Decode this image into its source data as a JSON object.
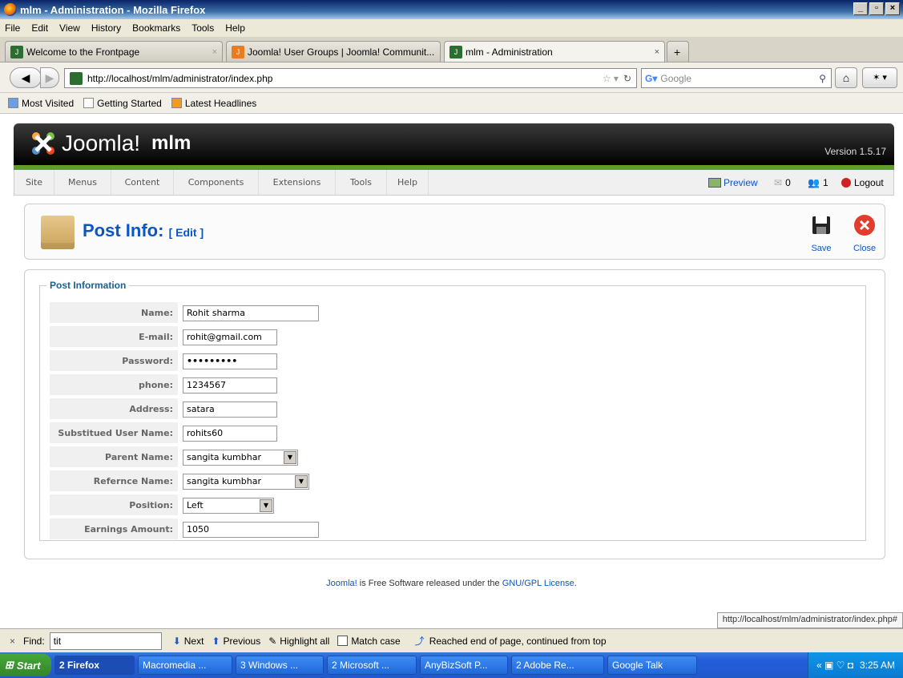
{
  "window": {
    "title": "mlm - Administration - Mozilla Firefox"
  },
  "menubar": [
    "File",
    "Edit",
    "View",
    "History",
    "Bookmarks",
    "Tools",
    "Help"
  ],
  "tabs": [
    {
      "label": "Welcome to the Frontpage"
    },
    {
      "label": "Joomla! User Groups | Joomla! Communit..."
    },
    {
      "label": "mlm - Administration"
    }
  ],
  "nav": {
    "url": "http://localhost/mlm/administrator/index.php",
    "search_placeholder": "Google"
  },
  "bookmarks": [
    "Most Visited",
    "Getting Started",
    "Latest Headlines"
  ],
  "joomla": {
    "brand": "Joomla!",
    "site": "mlm",
    "version": "Version 1.5.17",
    "menu": [
      "Site",
      "Menus",
      "Content",
      "Components",
      "Extensions",
      "Tools",
      "Help"
    ],
    "preview": "Preview",
    "messages": "0",
    "users": "1",
    "logout": "Logout"
  },
  "toolbar": {
    "title": "Post Info:",
    "subtitle": "[ Edit ]",
    "save": "Save",
    "close": "Close"
  },
  "form": {
    "legend": "Post Information",
    "fields": [
      {
        "label": "Name:",
        "value": "Rohit sharma",
        "type": "text"
      },
      {
        "label": "E-mail:",
        "value": "rohit@gmail.com",
        "type": "text"
      },
      {
        "label": "Password:",
        "value": "•••••••••",
        "type": "text"
      },
      {
        "label": "phone:",
        "value": "1234567",
        "type": "text"
      },
      {
        "label": "Address:",
        "value": "satara",
        "type": "text"
      },
      {
        "label": "Substitued User Name:",
        "value": "rohits60",
        "type": "text"
      },
      {
        "label": "Parent Name:",
        "value": "sangita kumbhar",
        "type": "select"
      },
      {
        "label": "Refernce Name:",
        "value": "sangita kumbhar",
        "type": "select"
      },
      {
        "label": "Position:",
        "value": "Left",
        "type": "select"
      },
      {
        "label": "Earnings Amount:",
        "value": "1050",
        "type": "text"
      }
    ]
  },
  "footer": {
    "link1": "Joomla!",
    "text": " is Free Software released under the ",
    "link2": "GNU/GPL License",
    "end": "."
  },
  "status": {
    "url": "http://localhost/mlm/administrator/index.php#"
  },
  "findbar": {
    "label": "Find:",
    "value": "tit",
    "next": "Next",
    "previous": "Previous",
    "highlight": "Highlight all",
    "match": "Match case",
    "message": "Reached end of page, continued from top"
  },
  "taskbar": {
    "start": "Start",
    "tasks": [
      "2 Firefox",
      "Macromedia ...",
      "3 Windows ...",
      "2 Microsoft ...",
      "AnyBizSoft P...",
      "2 Adobe Re...",
      "Google Talk"
    ],
    "time": "3:25 AM"
  }
}
